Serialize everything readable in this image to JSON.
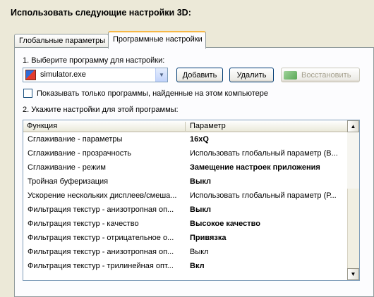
{
  "heading": "Использовать следующие настройки 3D:",
  "tabs": [
    {
      "label": "Глобальные параметры"
    },
    {
      "label": "Программные настройки"
    }
  ],
  "step1": {
    "label": "1. Выберите программу для настройки:",
    "program": "simulator.exe",
    "add_label": "Добавить",
    "remove_label": "Удалить",
    "restore_label": "Восстановить"
  },
  "filter_checkbox": {
    "label": "Показывать только программы, найденные на этом компьютере",
    "checked": false
  },
  "step2": {
    "label": "2. Укажите настройки для этой программы:",
    "columns": [
      "Функция",
      "Параметр"
    ],
    "rows": [
      {
        "feature": "Сглаживание - параметры",
        "value": "16xQ",
        "bold": true
      },
      {
        "feature": "Сглаживание - прозрачность",
        "value": "Использовать глобальный параметр (В...",
        "bold": false
      },
      {
        "feature": "Сглаживание - режим",
        "value": "Замещение настроек приложения",
        "bold": true
      },
      {
        "feature": "Тройная буферизация",
        "value": "Выкл",
        "bold": true
      },
      {
        "feature": "Ускорение нескольких дисплеев/смеша...",
        "value": "Использовать глобальный параметр (Р...",
        "bold": false
      },
      {
        "feature": "Фильтрация текстур - анизотропная оп...",
        "value": "Выкл",
        "bold": true
      },
      {
        "feature": "Фильтрация текстур - качество",
        "value": "Высокое качество",
        "bold": true
      },
      {
        "feature": "Фильтрация текстур - отрицательное о...",
        "value": "Привязка",
        "bold": true
      },
      {
        "feature": "Фильтрация текстур - анизотропная оп...",
        "value": "Выкл",
        "bold": false
      },
      {
        "feature": "Фильтрация текстур - трилинейная опт...",
        "value": "Вкл",
        "bold": true
      }
    ]
  }
}
